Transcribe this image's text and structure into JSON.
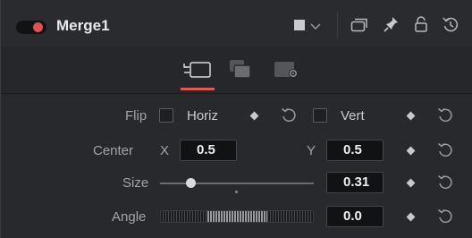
{
  "header": {
    "title": "Merge1",
    "enabled": true,
    "icons": [
      "square-icon",
      "chevron-down-icon",
      "copy-window-icon",
      "pin-icon",
      "lock-icon",
      "reset-all-icon"
    ]
  },
  "tabs": [
    {
      "name": "tab-controls",
      "icon": "controls-tab-icon",
      "active": true
    },
    {
      "name": "tab-channels",
      "icon": "channels-tab-icon",
      "active": false
    },
    {
      "name": "tab-settings",
      "icon": "settings-tab-icon",
      "active": false
    }
  ],
  "flip": {
    "label": "Flip",
    "horiz_label": "Horiz",
    "horiz_checked": false,
    "vert_label": "Vert",
    "vert_checked": false
  },
  "center": {
    "label": "Center",
    "x_label": "X",
    "x_value": "0.5",
    "y_label": "Y",
    "y_value": "0.5"
  },
  "size": {
    "label": "Size",
    "value": "0.31",
    "slider_fraction": 0.2
  },
  "angle": {
    "label": "Angle",
    "value": "0.0"
  },
  "colors": {
    "accent": "#e3574f",
    "panel": "#28292c"
  }
}
